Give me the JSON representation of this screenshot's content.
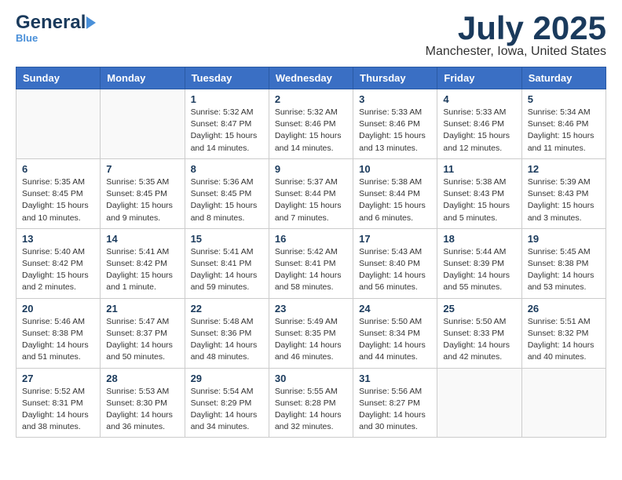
{
  "header": {
    "logo_general": "General",
    "logo_blue": "Blue",
    "month_title": "July 2025",
    "location": "Manchester, Iowa, United States"
  },
  "weekdays": [
    "Sunday",
    "Monday",
    "Tuesday",
    "Wednesday",
    "Thursday",
    "Friday",
    "Saturday"
  ],
  "weeks": [
    [
      {
        "day": "",
        "detail": ""
      },
      {
        "day": "",
        "detail": ""
      },
      {
        "day": "1",
        "detail": "Sunrise: 5:32 AM\nSunset: 8:47 PM\nDaylight: 15 hours\nand 14 minutes."
      },
      {
        "day": "2",
        "detail": "Sunrise: 5:32 AM\nSunset: 8:46 PM\nDaylight: 15 hours\nand 14 minutes."
      },
      {
        "day": "3",
        "detail": "Sunrise: 5:33 AM\nSunset: 8:46 PM\nDaylight: 15 hours\nand 13 minutes."
      },
      {
        "day": "4",
        "detail": "Sunrise: 5:33 AM\nSunset: 8:46 PM\nDaylight: 15 hours\nand 12 minutes."
      },
      {
        "day": "5",
        "detail": "Sunrise: 5:34 AM\nSunset: 8:46 PM\nDaylight: 15 hours\nand 11 minutes."
      }
    ],
    [
      {
        "day": "6",
        "detail": "Sunrise: 5:35 AM\nSunset: 8:45 PM\nDaylight: 15 hours\nand 10 minutes."
      },
      {
        "day": "7",
        "detail": "Sunrise: 5:35 AM\nSunset: 8:45 PM\nDaylight: 15 hours\nand 9 minutes."
      },
      {
        "day": "8",
        "detail": "Sunrise: 5:36 AM\nSunset: 8:45 PM\nDaylight: 15 hours\nand 8 minutes."
      },
      {
        "day": "9",
        "detail": "Sunrise: 5:37 AM\nSunset: 8:44 PM\nDaylight: 15 hours\nand 7 minutes."
      },
      {
        "day": "10",
        "detail": "Sunrise: 5:38 AM\nSunset: 8:44 PM\nDaylight: 15 hours\nand 6 minutes."
      },
      {
        "day": "11",
        "detail": "Sunrise: 5:38 AM\nSunset: 8:43 PM\nDaylight: 15 hours\nand 5 minutes."
      },
      {
        "day": "12",
        "detail": "Sunrise: 5:39 AM\nSunset: 8:43 PM\nDaylight: 15 hours\nand 3 minutes."
      }
    ],
    [
      {
        "day": "13",
        "detail": "Sunrise: 5:40 AM\nSunset: 8:42 PM\nDaylight: 15 hours\nand 2 minutes."
      },
      {
        "day": "14",
        "detail": "Sunrise: 5:41 AM\nSunset: 8:42 PM\nDaylight: 15 hours\nand 1 minute."
      },
      {
        "day": "15",
        "detail": "Sunrise: 5:41 AM\nSunset: 8:41 PM\nDaylight: 14 hours\nand 59 minutes."
      },
      {
        "day": "16",
        "detail": "Sunrise: 5:42 AM\nSunset: 8:41 PM\nDaylight: 14 hours\nand 58 minutes."
      },
      {
        "day": "17",
        "detail": "Sunrise: 5:43 AM\nSunset: 8:40 PM\nDaylight: 14 hours\nand 56 minutes."
      },
      {
        "day": "18",
        "detail": "Sunrise: 5:44 AM\nSunset: 8:39 PM\nDaylight: 14 hours\nand 55 minutes."
      },
      {
        "day": "19",
        "detail": "Sunrise: 5:45 AM\nSunset: 8:38 PM\nDaylight: 14 hours\nand 53 minutes."
      }
    ],
    [
      {
        "day": "20",
        "detail": "Sunrise: 5:46 AM\nSunset: 8:38 PM\nDaylight: 14 hours\nand 51 minutes."
      },
      {
        "day": "21",
        "detail": "Sunrise: 5:47 AM\nSunset: 8:37 PM\nDaylight: 14 hours\nand 50 minutes."
      },
      {
        "day": "22",
        "detail": "Sunrise: 5:48 AM\nSunset: 8:36 PM\nDaylight: 14 hours\nand 48 minutes."
      },
      {
        "day": "23",
        "detail": "Sunrise: 5:49 AM\nSunset: 8:35 PM\nDaylight: 14 hours\nand 46 minutes."
      },
      {
        "day": "24",
        "detail": "Sunrise: 5:50 AM\nSunset: 8:34 PM\nDaylight: 14 hours\nand 44 minutes."
      },
      {
        "day": "25",
        "detail": "Sunrise: 5:50 AM\nSunset: 8:33 PM\nDaylight: 14 hours\nand 42 minutes."
      },
      {
        "day": "26",
        "detail": "Sunrise: 5:51 AM\nSunset: 8:32 PM\nDaylight: 14 hours\nand 40 minutes."
      }
    ],
    [
      {
        "day": "27",
        "detail": "Sunrise: 5:52 AM\nSunset: 8:31 PM\nDaylight: 14 hours\nand 38 minutes."
      },
      {
        "day": "28",
        "detail": "Sunrise: 5:53 AM\nSunset: 8:30 PM\nDaylight: 14 hours\nand 36 minutes."
      },
      {
        "day": "29",
        "detail": "Sunrise: 5:54 AM\nSunset: 8:29 PM\nDaylight: 14 hours\nand 34 minutes."
      },
      {
        "day": "30",
        "detail": "Sunrise: 5:55 AM\nSunset: 8:28 PM\nDaylight: 14 hours\nand 32 minutes."
      },
      {
        "day": "31",
        "detail": "Sunrise: 5:56 AM\nSunset: 8:27 PM\nDaylight: 14 hours\nand 30 minutes."
      },
      {
        "day": "",
        "detail": ""
      },
      {
        "day": "",
        "detail": ""
      }
    ]
  ]
}
